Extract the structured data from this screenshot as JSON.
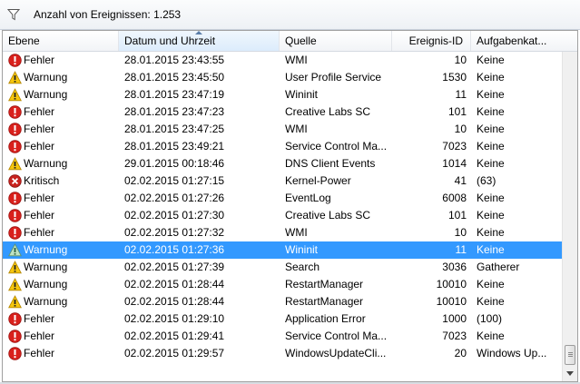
{
  "toolbar": {
    "count_text": "Anzahl von Ereignissen: 1.253",
    "filter_icon": "filter-funnel-icon"
  },
  "columns": [
    {
      "key": "level",
      "label": "Ebene"
    },
    {
      "key": "datetime",
      "label": "Datum und Uhrzeit",
      "sorted": "ascending"
    },
    {
      "key": "source",
      "label": "Quelle"
    },
    {
      "key": "event_id",
      "label": "Ereignis-ID"
    },
    {
      "key": "task",
      "label": "Aufgabenkat..."
    }
  ],
  "colors": {
    "selection": "#3399ff",
    "error_icon": "#d9201c",
    "warning_icon": "#f5c50c",
    "critical_icon": "#c8221e"
  },
  "rows": [
    {
      "level": "Fehler",
      "icon": "error-icon",
      "datetime": "28.01.2015 23:43:55",
      "source": "WMI",
      "event_id": "10",
      "task": "Keine"
    },
    {
      "level": "Warnung",
      "icon": "warning-icon",
      "datetime": "28.01.2015 23:45:50",
      "source": "User Profile Service",
      "event_id": "1530",
      "task": "Keine"
    },
    {
      "level": "Warnung",
      "icon": "warning-icon",
      "datetime": "28.01.2015 23:47:19",
      "source": "Wininit",
      "event_id": "11",
      "task": "Keine"
    },
    {
      "level": "Fehler",
      "icon": "error-icon",
      "datetime": "28.01.2015 23:47:23",
      "source": "Creative Labs SC",
      "event_id": "101",
      "task": "Keine"
    },
    {
      "level": "Fehler",
      "icon": "error-icon",
      "datetime": "28.01.2015 23:47:25",
      "source": "WMI",
      "event_id": "10",
      "task": "Keine"
    },
    {
      "level": "Fehler",
      "icon": "error-icon",
      "datetime": "28.01.2015 23:49:21",
      "source": "Service Control Ma...",
      "event_id": "7023",
      "task": "Keine"
    },
    {
      "level": "Warnung",
      "icon": "warning-icon",
      "datetime": "29.01.2015 00:18:46",
      "source": "DNS Client Events",
      "event_id": "1014",
      "task": "Keine"
    },
    {
      "level": "Kritisch",
      "icon": "critical-icon",
      "datetime": "02.02.2015 01:27:15",
      "source": "Kernel-Power",
      "event_id": "41",
      "task": "(63)"
    },
    {
      "level": "Fehler",
      "icon": "error-icon",
      "datetime": "02.02.2015 01:27:26",
      "source": "EventLog",
      "event_id": "6008",
      "task": "Keine"
    },
    {
      "level": "Fehler",
      "icon": "error-icon",
      "datetime": "02.02.2015 01:27:30",
      "source": "Creative Labs SC",
      "event_id": "101",
      "task": "Keine"
    },
    {
      "level": "Fehler",
      "icon": "error-icon",
      "datetime": "02.02.2015 01:27:32",
      "source": "WMI",
      "event_id": "10",
      "task": "Keine"
    },
    {
      "level": "Warnung",
      "icon": "warning-icon",
      "datetime": "02.02.2015 01:27:36",
      "source": "Wininit",
      "event_id": "11",
      "task": "Keine",
      "selected": true
    },
    {
      "level": "Warnung",
      "icon": "warning-icon",
      "datetime": "02.02.2015 01:27:39",
      "source": "Search",
      "event_id": "3036",
      "task": "Gatherer"
    },
    {
      "level": "Warnung",
      "icon": "warning-icon",
      "datetime": "02.02.2015 01:28:44",
      "source": "RestartManager",
      "event_id": "10010",
      "task": "Keine"
    },
    {
      "level": "Warnung",
      "icon": "warning-icon",
      "datetime": "02.02.2015 01:28:44",
      "source": "RestartManager",
      "event_id": "10010",
      "task": "Keine"
    },
    {
      "level": "Fehler",
      "icon": "error-icon",
      "datetime": "02.02.2015 01:29:10",
      "source": "Application Error",
      "event_id": "1000",
      "task": "(100)"
    },
    {
      "level": "Fehler",
      "icon": "error-icon",
      "datetime": "02.02.2015 01:29:41",
      "source": "Service Control Ma...",
      "event_id": "7023",
      "task": "Keine"
    },
    {
      "level": "Fehler",
      "icon": "error-icon",
      "datetime": "02.02.2015 01:29:57",
      "source": "WindowsUpdateCli...",
      "event_id": "20",
      "task": "Windows Up..."
    }
  ]
}
